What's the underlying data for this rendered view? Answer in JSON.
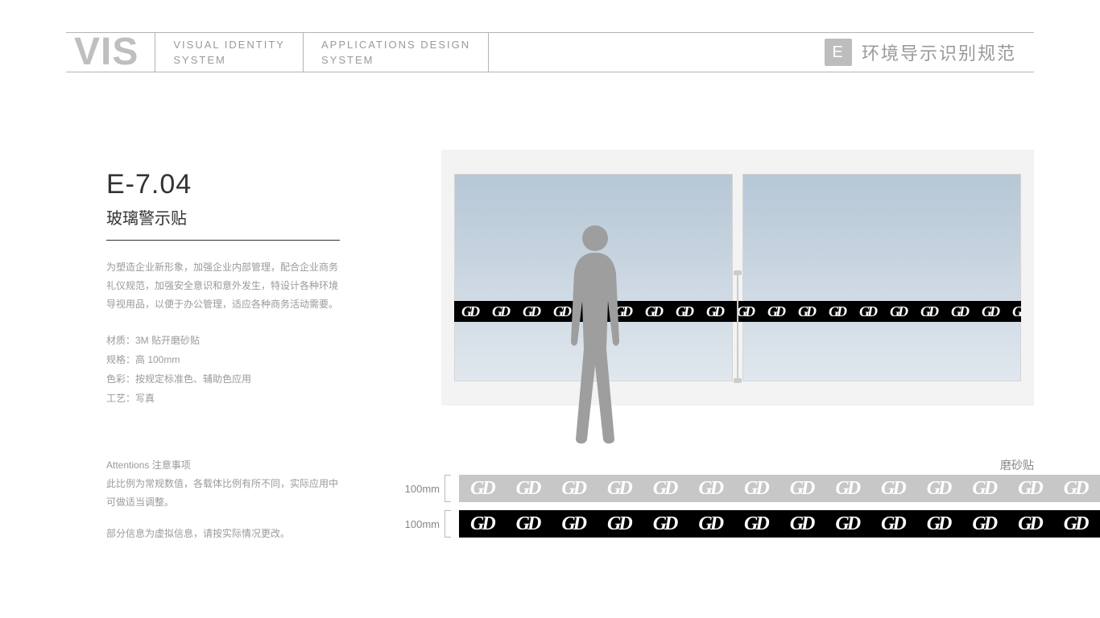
{
  "header": {
    "brand": "VIS",
    "col1_l1": "VISUAL IDENTITY",
    "col1_l2": "SYSTEM",
    "col2_l1": "APPLICATIONS DESIGN",
    "col2_l2": "SYSTEM",
    "badge": "E",
    "right": "环境导示识别规范"
  },
  "left": {
    "code": "E-7.04",
    "title": "玻璃警示贴",
    "para": "为塑造企业新形象，加强企业内部管理，配合企业商务礼仪规范，加强安全意识和意外发生，特设计各种环境导视用品，以便于办公管理，适应各种商务活动需要。",
    "spec_material": "材质：3M 贴开磨砂贴",
    "spec_size": "规格：高 100mm",
    "spec_color": "色彩：按规定标准色、辅助色应用",
    "spec_craft": "工艺：写真",
    "att_title": "Attentions 注意事项",
    "att_body": "此比例为常规数值，各载体比例有所不同，实际应用中可做适当调整。",
    "att_note": "部分信息为虚拟信息，请按实际情况更改。"
  },
  "samples": {
    "frost": "磨砂贴",
    "dim1": "100mm",
    "dim2": "100mm"
  },
  "logo_glyph": "GD"
}
